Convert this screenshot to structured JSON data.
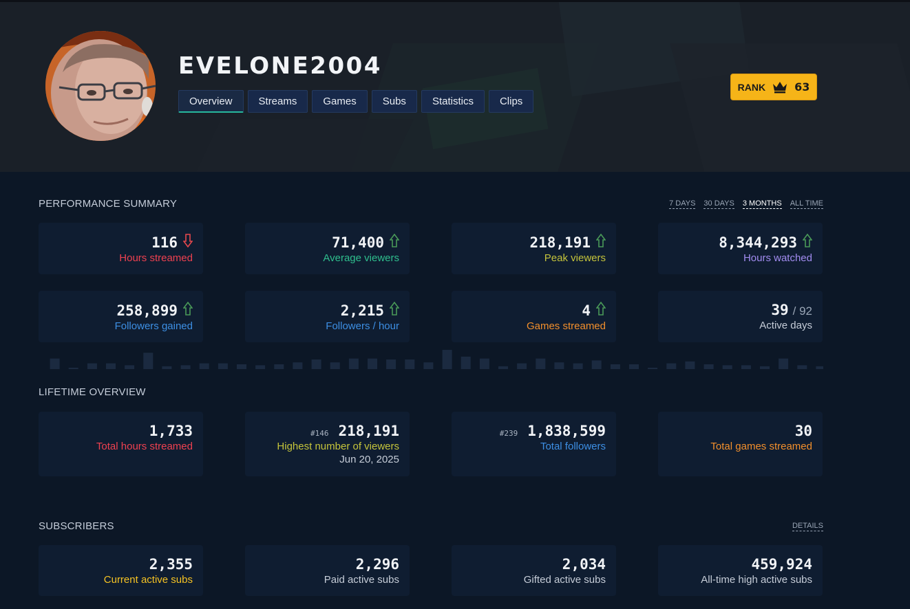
{
  "channel": {
    "name": "EVELONE2004"
  },
  "tabs": [
    "Overview",
    "Streams",
    "Games",
    "Subs",
    "Statistics",
    "Clips"
  ],
  "rank": {
    "label": "RANK",
    "value": "63"
  },
  "performance": {
    "title": "PERFORMANCE SUMMARY",
    "ranges": [
      "7 DAYS",
      "30 DAYS",
      "3 MONTHS",
      "ALL TIME"
    ],
    "selected_range": "3 MONTHS",
    "cards": [
      {
        "value": "116",
        "label": "Hours streamed",
        "trend": "down"
      },
      {
        "value": "71,400",
        "label": "Average viewers",
        "trend": "up"
      },
      {
        "value": "218,191",
        "label": "Peak viewers",
        "trend": "up"
      },
      {
        "value": "8,344,293",
        "label": "Hours watched",
        "trend": "up"
      },
      {
        "value": "258,899",
        "label": "Followers gained",
        "trend": "up"
      },
      {
        "value": "2,215",
        "label": "Followers / hour",
        "trend": "up"
      },
      {
        "value": "4",
        "label": "Games streamed",
        "trend": "up"
      },
      {
        "value": "39",
        "of": "/ 92",
        "label": "Active days"
      }
    ]
  },
  "lifetime": {
    "title": "LIFETIME OVERVIEW",
    "cards": [
      {
        "value": "1,733",
        "label": "Total hours streamed"
      },
      {
        "rank": "#146",
        "value": "218,191",
        "label": "Highest number of viewers",
        "date": "Jun 20, 2025"
      },
      {
        "rank": "#239",
        "value": "1,838,599",
        "label": "Total followers"
      },
      {
        "value": "30",
        "label": "Total games streamed"
      }
    ]
  },
  "subscribers": {
    "title": "SUBSCRIBERS",
    "details_label": "DETAILS",
    "cards": [
      {
        "value": "2,355",
        "label": "Current active subs"
      },
      {
        "value": "2,296",
        "label": "Paid active subs"
      },
      {
        "value": "2,034",
        "label": "Gifted active subs"
      },
      {
        "value": "459,924",
        "label": "All-time high active subs"
      }
    ]
  },
  "activity_bars": [
    0.55,
    0.05,
    0.3,
    0.3,
    0.2,
    0.85,
    0.15,
    0.2,
    0.3,
    0.3,
    0.25,
    0.2,
    0.25,
    0.35,
    0.5,
    0.35,
    0.55,
    0.55,
    0.5,
    0.5,
    0.35,
    1.0,
    0.65,
    0.55,
    0.15,
    0.3,
    0.55,
    0.35,
    0.3,
    0.45,
    0.25,
    0.25,
    0.05,
    0.3,
    0.4,
    0.25,
    0.2,
    0.2,
    0.15,
    0.55,
    0.2,
    0.15
  ],
  "colors": {
    "red": "#ef4150",
    "teal": "#2fbf8e",
    "olive": "#c5c43b",
    "purple": "#a28cf0",
    "blue": "#3d8fe4",
    "orange": "#f28f2c",
    "gold": "#f6c323",
    "up_arrow": "#4a9a58",
    "down_arrow": "#e5484d",
    "rank_badge": "#f6b418"
  }
}
